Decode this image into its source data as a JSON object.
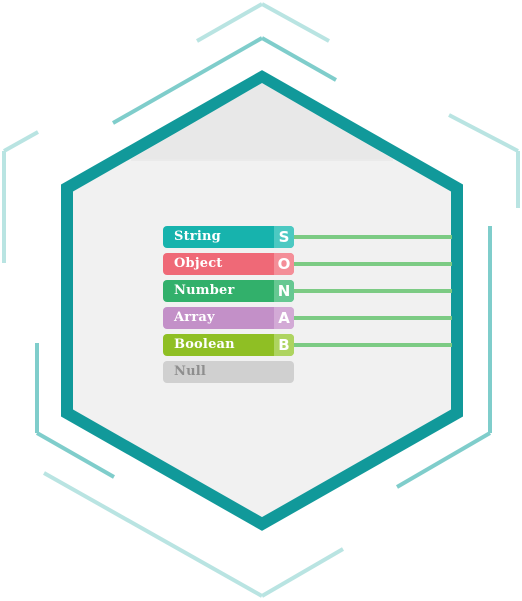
{
  "types": [
    {
      "label": "String",
      "letter": "S",
      "color": "#17b3ad",
      "letter_bg": "#4cc9c2"
    },
    {
      "label": "Object",
      "letter": "O",
      "color": "#ef6977",
      "letter_bg": "#f48e98"
    },
    {
      "label": "Number",
      "letter": "N",
      "color": "#32b06b",
      "letter_bg": "#66c892"
    },
    {
      "label": "Array",
      "letter": "A",
      "color": "#c390c8",
      "letter_bg": "#d3aad6"
    },
    {
      "label": "Boolean",
      "letter": "B",
      "color": "#8fbf24",
      "letter_bg": "#aed460"
    },
    {
      "label": "Null",
      "letter": "",
      "color": "#d0d0d0",
      "letter_bg": ""
    }
  ],
  "colors": {
    "hex_border": "#11999a",
    "hex_fill": "#f1f1f1",
    "hex_top_fill": "#e8e8e8",
    "outline_dark": "#7fcdcb",
    "outline_light": "#b9e4e2",
    "connector": "#7ccb84"
  }
}
